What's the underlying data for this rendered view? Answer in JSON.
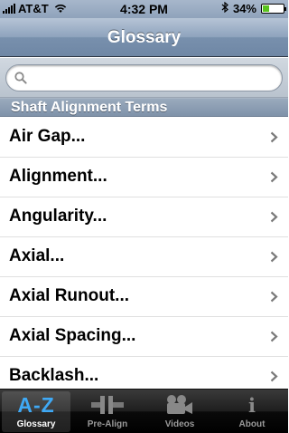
{
  "status_bar": {
    "carrier": "AT&T",
    "time": "4:32 PM",
    "battery_percent": "34%",
    "battery_level": 0.34,
    "icons": [
      "signal-bars-icon",
      "wifi-icon",
      "bluetooth-icon",
      "battery-charging-icon"
    ]
  },
  "nav": {
    "title": "Glossary"
  },
  "search": {
    "placeholder": "",
    "value": ""
  },
  "section": {
    "header": "Shaft Alignment Terms"
  },
  "list": {
    "items": [
      {
        "label": "Air Gap..."
      },
      {
        "label": "Alignment..."
      },
      {
        "label": "Angularity..."
      },
      {
        "label": "Axial..."
      },
      {
        "label": "Axial Runout..."
      },
      {
        "label": "Axial Spacing..."
      },
      {
        "label": "Backlash..."
      }
    ]
  },
  "tabs": [
    {
      "label": "Glossary",
      "icon": "a-z-icon",
      "glyph": "A-Z",
      "selected": true
    },
    {
      "label": "Pre-Align",
      "icon": "shaft-align-icon",
      "selected": false
    },
    {
      "label": "Videos",
      "icon": "video-camera-icon",
      "selected": false
    },
    {
      "label": "About",
      "icon": "info-icon",
      "glyph": "i",
      "selected": false
    }
  ],
  "colors": {
    "selected_tab_glyph": "#3fa9f5",
    "battery_fill": "#59c31e",
    "nav_bar": "#8ea3bd"
  }
}
